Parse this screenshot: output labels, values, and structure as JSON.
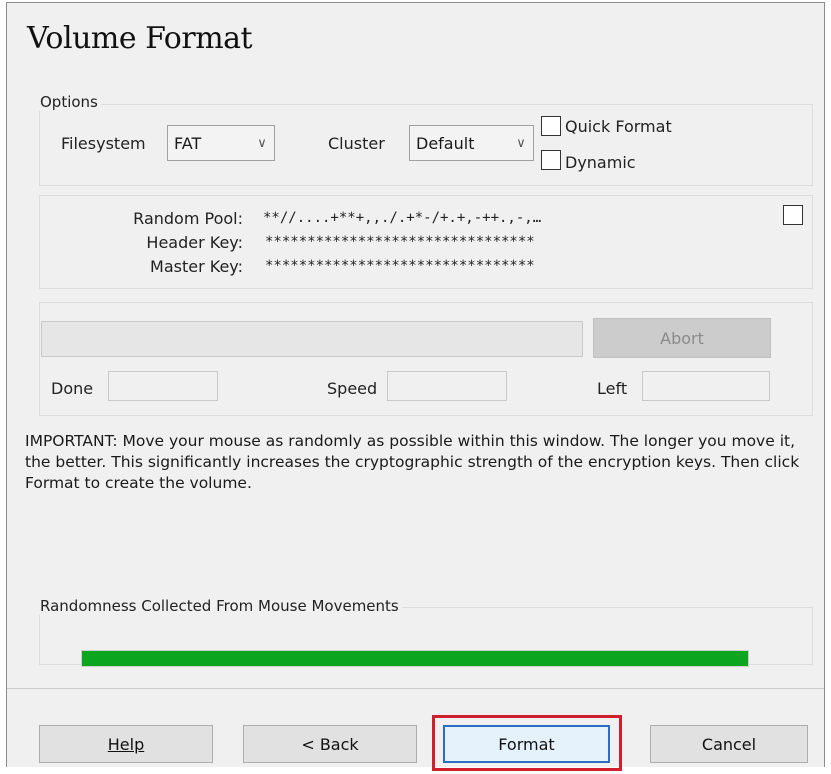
{
  "title": "Volume Format",
  "options": {
    "group_label": "Options",
    "filesystem_label": "Filesystem",
    "filesystem_value": "FAT",
    "cluster_label": "Cluster",
    "cluster_value": "Default",
    "quick_format_label": "Quick Format",
    "dynamic_label": "Dynamic"
  },
  "keys": {
    "random_pool_label": "Random Pool:",
    "random_pool_value": "**//....+**+,,./.+*-/+.+,-++.,-,…",
    "header_key_label": "Header Key:",
    "header_key_value": "********************************",
    "master_key_label": "Master Key:",
    "master_key_value": "********************************"
  },
  "progress": {
    "abort_label": "Abort",
    "done_label": "Done",
    "speed_label": "Speed",
    "left_label": "Left"
  },
  "important_text": "IMPORTANT: Move your mouse as randomly as possible within this window. The longer you move it, the better. This significantly increases the cryptographic strength of the encryption keys. Then click Format to create the volume.",
  "randomness": {
    "label": "Randomness Collected From Mouse Movements",
    "bar_color": "#0ca51f",
    "fill_fraction": 1.0
  },
  "buttons": {
    "help": "Help",
    "back": "< Back",
    "format": "Format",
    "cancel": "Cancel"
  },
  "colors": {
    "format_highlight": "#d0202e",
    "default_button_border": "#2a6ec2"
  }
}
